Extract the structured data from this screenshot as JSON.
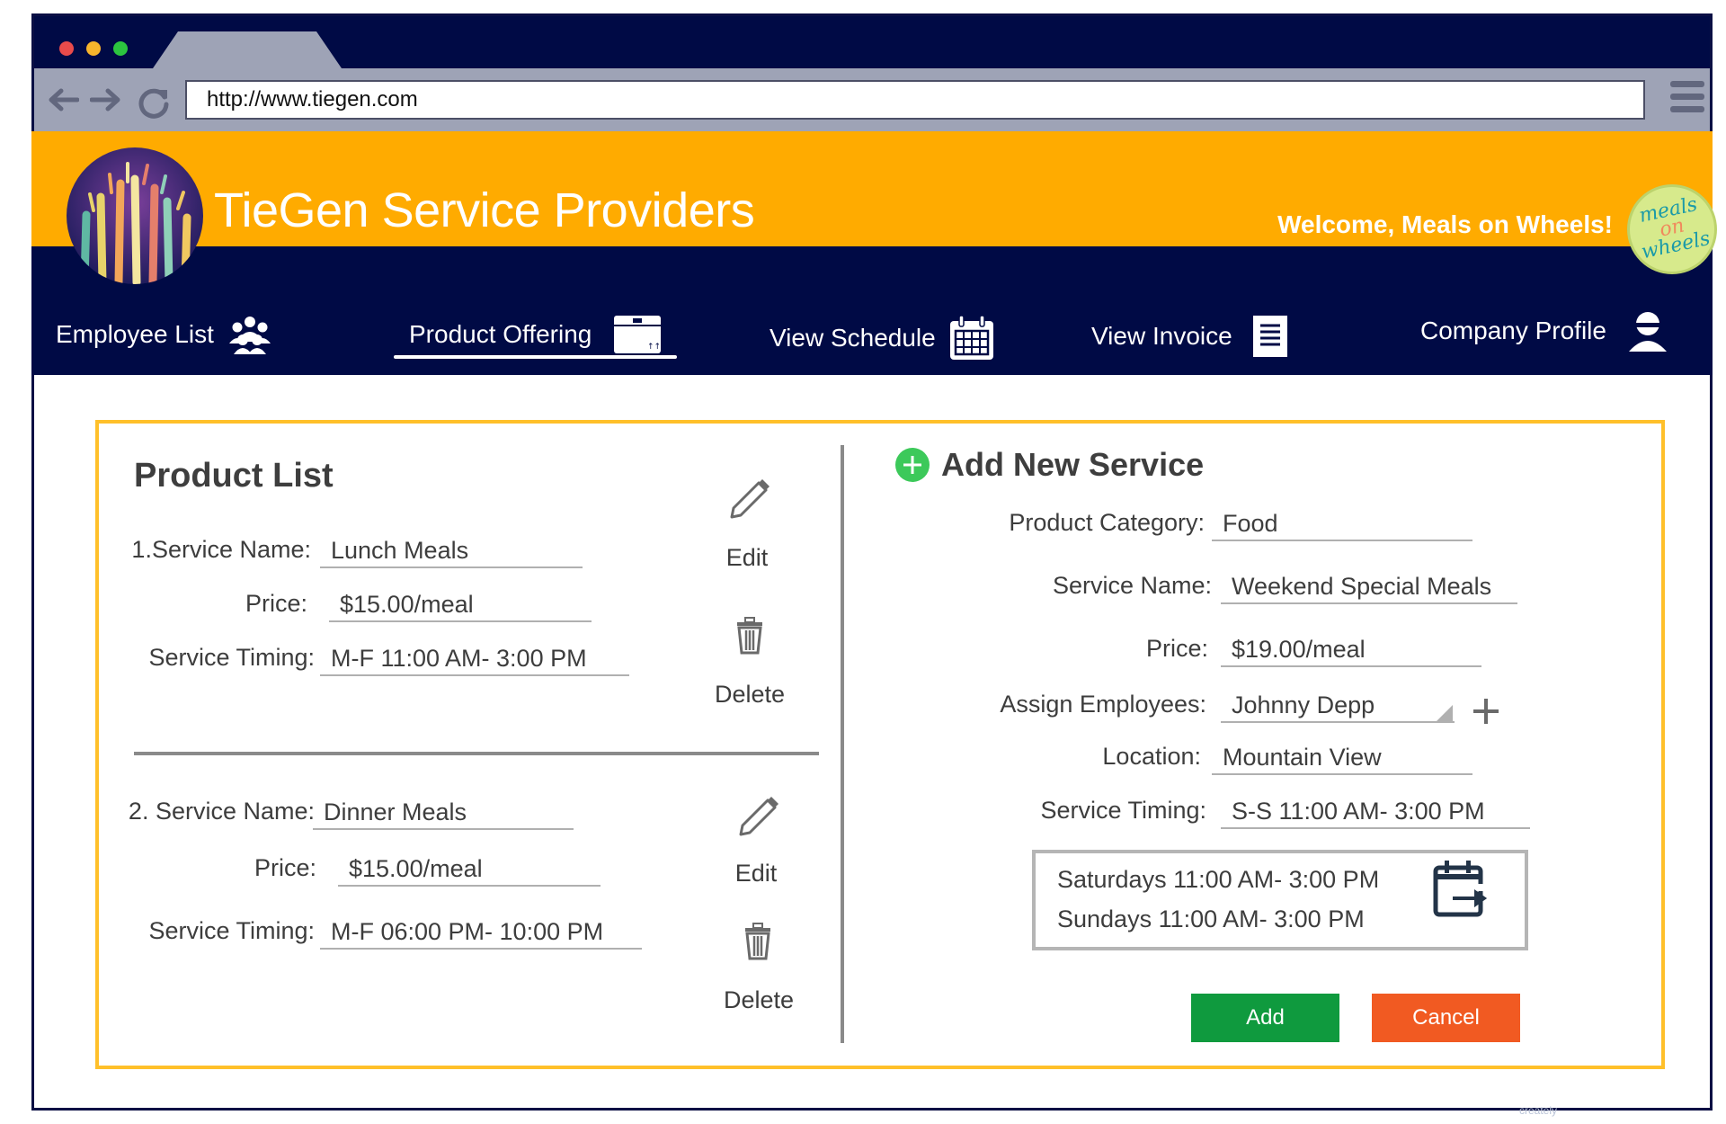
{
  "browser": {
    "url": "http://www.tiegen.com",
    "traffic_lights": [
      "#e94b4b",
      "#f7b52c",
      "#2cc53f"
    ]
  },
  "header": {
    "brand": "TieGen Service Providers",
    "welcome": "Welcome, Meals on Wheels!",
    "partner_logo_text": [
      "meals",
      "on",
      "wheels"
    ]
  },
  "nav": {
    "items": [
      {
        "label": "Employee List",
        "icon": "people-group-icon"
      },
      {
        "label": "Product Offering",
        "icon": "box-icon",
        "active": true
      },
      {
        "label": "View Schedule",
        "icon": "calendar-icon"
      },
      {
        "label": "View Invoice",
        "icon": "invoice-icon"
      },
      {
        "label": "Company Profile",
        "icon": "user-icon"
      }
    ]
  },
  "product_list": {
    "title": "Product List",
    "items": [
      {
        "service_name_label": "1.Service Name:",
        "service_name": "Lunch Meals",
        "price_label": "Price:",
        "price": "$15.00/meal",
        "timing_label": "Service Timing:",
        "timing": "M-F 11:00 AM- 3:00 PM",
        "edit_label": "Edit",
        "delete_label": "Delete"
      },
      {
        "service_name_label": "2. Service Name:",
        "service_name": "Dinner Meals",
        "price_label": "Price:",
        "price": "$15.00/meal",
        "timing_label": "Service Timing:",
        "timing": "M-F 06:00 PM- 10:00 PM",
        "edit_label": "Edit",
        "delete_label": "Delete"
      }
    ]
  },
  "add_service": {
    "title": "Add New Service",
    "category_label": "Product Category:",
    "category": "Food",
    "service_name_label": "Service Name:",
    "service_name": "Weekend Special Meals",
    "price_label": "Price:",
    "price": "$19.00/meal",
    "assign_label": "Assign Employees:",
    "assign": "Johnny Depp",
    "location_label": "Location:",
    "location": "Mountain View",
    "timing_label": "Service Timing:",
    "timing": "S-S 11:00 AM- 3:00 PM",
    "timing_details": [
      "Saturdays 11:00 AM- 3:00 PM",
      "Sundays 11:00 AM- 3:00 PM"
    ],
    "add_label": "Add",
    "cancel_label": "Cancel",
    "colors": {
      "add": "#0f9a3e",
      "cancel": "#f15a22",
      "plus": "#3cc95a"
    }
  },
  "watermark": "creately"
}
